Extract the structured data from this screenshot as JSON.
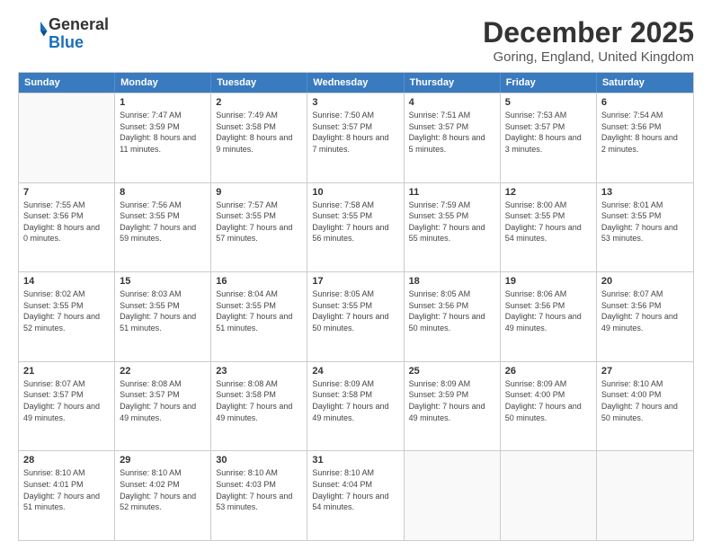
{
  "header": {
    "logo": {
      "line1": "General",
      "line2": "Blue"
    },
    "title": "December 2025",
    "location": "Goring, England, United Kingdom"
  },
  "weekdays": [
    "Sunday",
    "Monday",
    "Tuesday",
    "Wednesday",
    "Thursday",
    "Friday",
    "Saturday"
  ],
  "weeks": [
    [
      {
        "day": "",
        "empty": true
      },
      {
        "day": "1",
        "sunrise": "7:47 AM",
        "sunset": "3:59 PM",
        "daylight": "8 hours and 11 minutes."
      },
      {
        "day": "2",
        "sunrise": "7:49 AM",
        "sunset": "3:58 PM",
        "daylight": "8 hours and 9 minutes."
      },
      {
        "day": "3",
        "sunrise": "7:50 AM",
        "sunset": "3:57 PM",
        "daylight": "8 hours and 7 minutes."
      },
      {
        "day": "4",
        "sunrise": "7:51 AM",
        "sunset": "3:57 PM",
        "daylight": "8 hours and 5 minutes."
      },
      {
        "day": "5",
        "sunrise": "7:53 AM",
        "sunset": "3:57 PM",
        "daylight": "8 hours and 3 minutes."
      },
      {
        "day": "6",
        "sunrise": "7:54 AM",
        "sunset": "3:56 PM",
        "daylight": "8 hours and 2 minutes."
      }
    ],
    [
      {
        "day": "7",
        "sunrise": "7:55 AM",
        "sunset": "3:56 PM",
        "daylight": "8 hours and 0 minutes."
      },
      {
        "day": "8",
        "sunrise": "7:56 AM",
        "sunset": "3:55 PM",
        "daylight": "7 hours and 59 minutes."
      },
      {
        "day": "9",
        "sunrise": "7:57 AM",
        "sunset": "3:55 PM",
        "daylight": "7 hours and 57 minutes."
      },
      {
        "day": "10",
        "sunrise": "7:58 AM",
        "sunset": "3:55 PM",
        "daylight": "7 hours and 56 minutes."
      },
      {
        "day": "11",
        "sunrise": "7:59 AM",
        "sunset": "3:55 PM",
        "daylight": "7 hours and 55 minutes."
      },
      {
        "day": "12",
        "sunrise": "8:00 AM",
        "sunset": "3:55 PM",
        "daylight": "7 hours and 54 minutes."
      },
      {
        "day": "13",
        "sunrise": "8:01 AM",
        "sunset": "3:55 PM",
        "daylight": "7 hours and 53 minutes."
      }
    ],
    [
      {
        "day": "14",
        "sunrise": "8:02 AM",
        "sunset": "3:55 PM",
        "daylight": "7 hours and 52 minutes."
      },
      {
        "day": "15",
        "sunrise": "8:03 AM",
        "sunset": "3:55 PM",
        "daylight": "7 hours and 51 minutes."
      },
      {
        "day": "16",
        "sunrise": "8:04 AM",
        "sunset": "3:55 PM",
        "daylight": "7 hours and 51 minutes."
      },
      {
        "day": "17",
        "sunrise": "8:05 AM",
        "sunset": "3:55 PM",
        "daylight": "7 hours and 50 minutes."
      },
      {
        "day": "18",
        "sunrise": "8:05 AM",
        "sunset": "3:56 PM",
        "daylight": "7 hours and 50 minutes."
      },
      {
        "day": "19",
        "sunrise": "8:06 AM",
        "sunset": "3:56 PM",
        "daylight": "7 hours and 49 minutes."
      },
      {
        "day": "20",
        "sunrise": "8:07 AM",
        "sunset": "3:56 PM",
        "daylight": "7 hours and 49 minutes."
      }
    ],
    [
      {
        "day": "21",
        "sunrise": "8:07 AM",
        "sunset": "3:57 PM",
        "daylight": "7 hours and 49 minutes."
      },
      {
        "day": "22",
        "sunrise": "8:08 AM",
        "sunset": "3:57 PM",
        "daylight": "7 hours and 49 minutes."
      },
      {
        "day": "23",
        "sunrise": "8:08 AM",
        "sunset": "3:58 PM",
        "daylight": "7 hours and 49 minutes."
      },
      {
        "day": "24",
        "sunrise": "8:09 AM",
        "sunset": "3:58 PM",
        "daylight": "7 hours and 49 minutes."
      },
      {
        "day": "25",
        "sunrise": "8:09 AM",
        "sunset": "3:59 PM",
        "daylight": "7 hours and 49 minutes."
      },
      {
        "day": "26",
        "sunrise": "8:09 AM",
        "sunset": "4:00 PM",
        "daylight": "7 hours and 50 minutes."
      },
      {
        "day": "27",
        "sunrise": "8:10 AM",
        "sunset": "4:00 PM",
        "daylight": "7 hours and 50 minutes."
      }
    ],
    [
      {
        "day": "28",
        "sunrise": "8:10 AM",
        "sunset": "4:01 PM",
        "daylight": "7 hours and 51 minutes."
      },
      {
        "day": "29",
        "sunrise": "8:10 AM",
        "sunset": "4:02 PM",
        "daylight": "7 hours and 52 minutes."
      },
      {
        "day": "30",
        "sunrise": "8:10 AM",
        "sunset": "4:03 PM",
        "daylight": "7 hours and 53 minutes."
      },
      {
        "day": "31",
        "sunrise": "8:10 AM",
        "sunset": "4:04 PM",
        "daylight": "7 hours and 54 minutes."
      },
      {
        "day": "",
        "empty": true
      },
      {
        "day": "",
        "empty": true
      },
      {
        "day": "",
        "empty": true
      }
    ]
  ],
  "labels": {
    "sunrise": "Sunrise:",
    "sunset": "Sunset:",
    "daylight": "Daylight:"
  }
}
